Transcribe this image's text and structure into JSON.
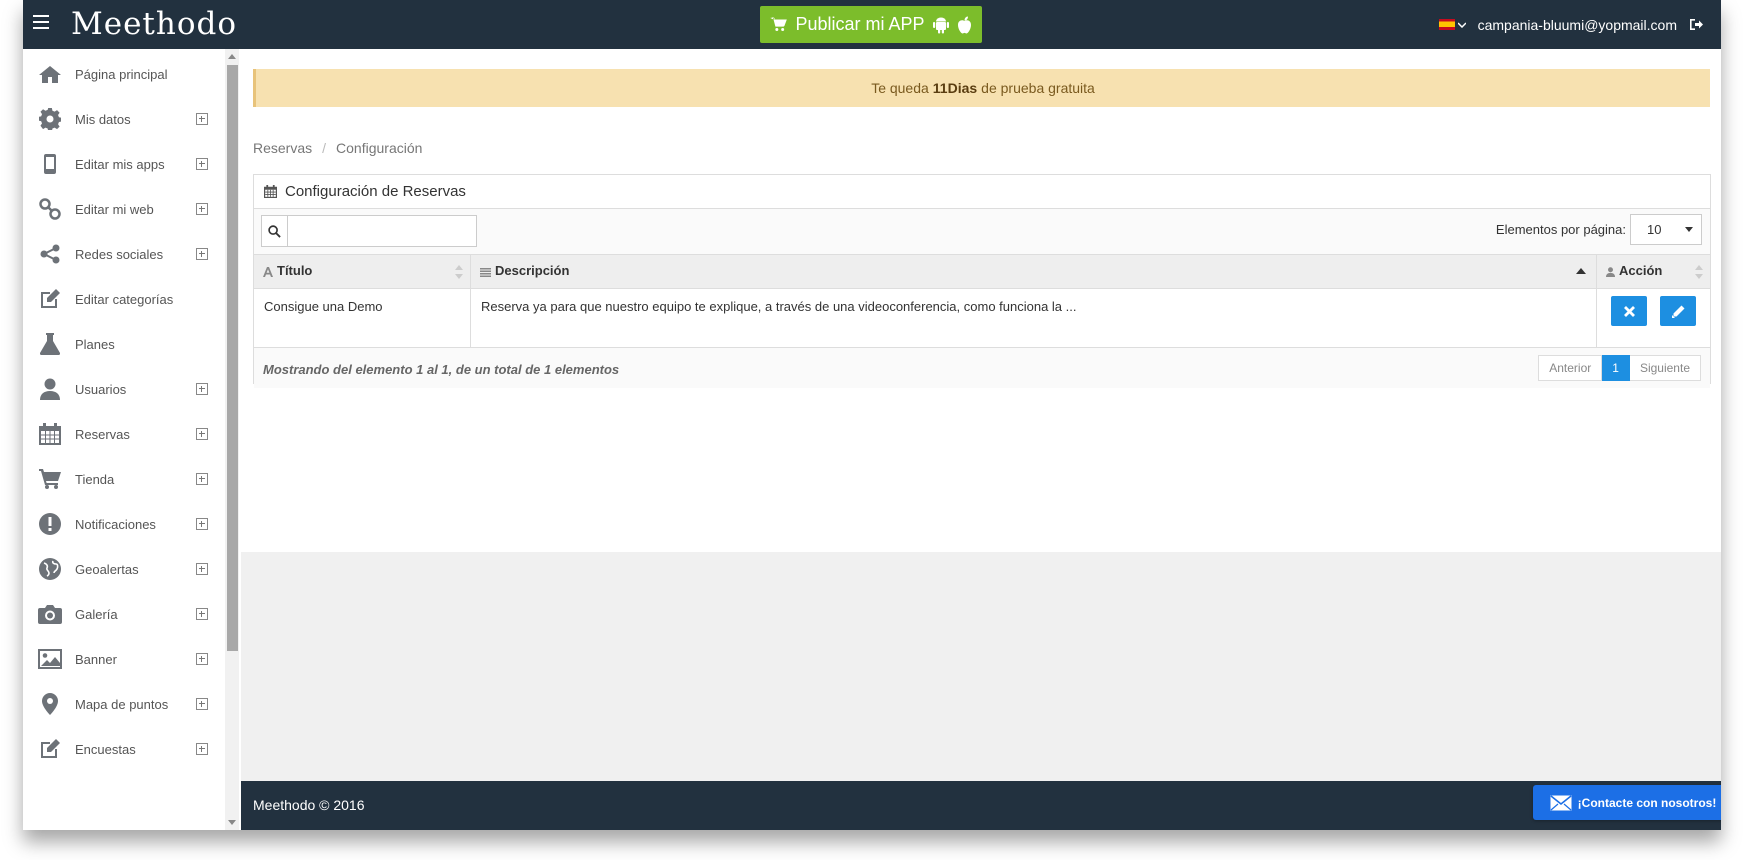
{
  "header": {
    "logo": "Meethodo",
    "publish_label": "Publicar mi APP",
    "user_email": "campania-bluumi@yopmail.com"
  },
  "sidebar": {
    "items": [
      {
        "label": "Página principal",
        "icon": "home-icon",
        "expandable": false
      },
      {
        "label": "Mis datos",
        "icon": "gear-icon",
        "expandable": true
      },
      {
        "label": "Editar mis apps",
        "icon": "mobile-icon",
        "expandable": true
      },
      {
        "label": "Editar mi web",
        "icon": "link-icon",
        "expandable": true
      },
      {
        "label": "Redes sociales",
        "icon": "share-icon",
        "expandable": true
      },
      {
        "label": "Editar categorías",
        "icon": "edit-icon",
        "expandable": false
      },
      {
        "label": "Planes",
        "icon": "flask-icon",
        "expandable": false
      },
      {
        "label": "Usuarios",
        "icon": "user-icon",
        "expandable": true
      },
      {
        "label": "Reservas",
        "icon": "calendar-icon",
        "expandable": true
      },
      {
        "label": "Tienda",
        "icon": "cart-icon",
        "expandable": true
      },
      {
        "label": "Notificaciones",
        "icon": "alert-icon",
        "expandable": true
      },
      {
        "label": "Geoalertas",
        "icon": "globe-icon",
        "expandable": true
      },
      {
        "label": "Galería",
        "icon": "camera-icon",
        "expandable": true
      },
      {
        "label": "Banner",
        "icon": "image-icon",
        "expandable": true
      },
      {
        "label": "Mapa de puntos",
        "icon": "map-marker-icon",
        "expandable": true
      },
      {
        "label": "Encuestas",
        "icon": "edit-icon",
        "expandable": true
      }
    ]
  },
  "trial": {
    "prefix": "Te queda",
    "days": "11Dias",
    "suffix": "de prueba gratuita"
  },
  "breadcrumb": {
    "items": [
      "Reservas",
      "Configuración"
    ],
    "separator": "/"
  },
  "panel": {
    "title": "Configuración de Reservas",
    "search_value": "",
    "per_page_label": "Elementos por página:",
    "per_page_value": "10",
    "columns": [
      "Título",
      "Descripción",
      "Acción"
    ],
    "rows": [
      {
        "title": "Consigue una Demo",
        "description": "Reserva ya para que nuestro equipo te explique, a través de una videoconferencia, como funciona la ..."
      }
    ],
    "showing": "Mostrando del elemento 1 al 1, de un total de 1 elementos",
    "pager": {
      "prev": "Anterior",
      "current": "1",
      "next": "Siguiente"
    }
  },
  "footer": {
    "copyright": "Meethodo © 2016",
    "contact_label": "¡Contacte con nosotros!"
  },
  "colors": {
    "topbar": "#22313f",
    "publish": "#7cbd2b",
    "accent": "#1d8fe1",
    "trial_bg": "#f7e1b0"
  }
}
